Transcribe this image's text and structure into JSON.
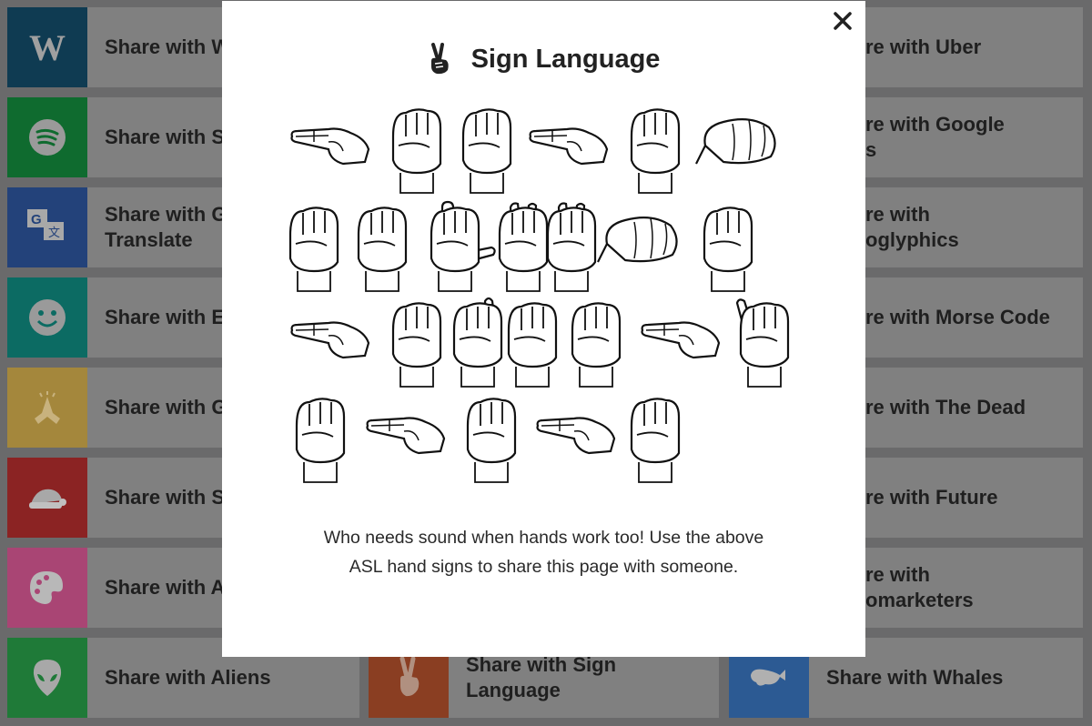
{
  "cards": {
    "left": [
      {
        "label": "Share with W",
        "icon": "wikipedia-icon",
        "color": "#0f3b52"
      },
      {
        "label": "Share with S",
        "icon": "spotify-icon",
        "color": "#0f6b2f"
      },
      {
        "label": "Share with G\nTranslate",
        "icon": "google-translate-icon",
        "color": "#23427a"
      },
      {
        "label": "Share with E",
        "icon": "smiley-icon",
        "color": "#0c6b63"
      },
      {
        "label": "Share with G",
        "icon": "praying-hands-icon",
        "color": "#a4873c"
      },
      {
        "label": "Share with S",
        "icon": "santa-hat-icon",
        "color": "#8b2323"
      },
      {
        "label": "Share with A",
        "icon": "palette-icon",
        "color": "#a94574"
      },
      {
        "label": "Share with Aliens",
        "icon": "alien-icon",
        "color": "#1f7a38"
      }
    ],
    "middle": [
      {
        "label": "Share with Sign\nLanguage",
        "icon": "peace-hand-icon",
        "color": "#8a3e22"
      }
    ],
    "right": [
      {
        "label": "re with Uber"
      },
      {
        "label": "re with Google\ns"
      },
      {
        "label": "re with\noglyphics"
      },
      {
        "label": "re with Morse Code"
      },
      {
        "label": "re with The Dead"
      },
      {
        "label": "re with Future"
      },
      {
        "label": "re with\nomarketers"
      },
      {
        "label": "Share with Whales",
        "icon": "whale-icon",
        "color": "#2c5a93"
      }
    ]
  },
  "modal": {
    "title": "Sign Language",
    "title_icon": "peace-hand-icon",
    "close_icon": "close-icon",
    "image": "asl-hand-signs",
    "description": "Who needs sound when hands work too! Use the above ASL hand signs to share this page with someone."
  }
}
